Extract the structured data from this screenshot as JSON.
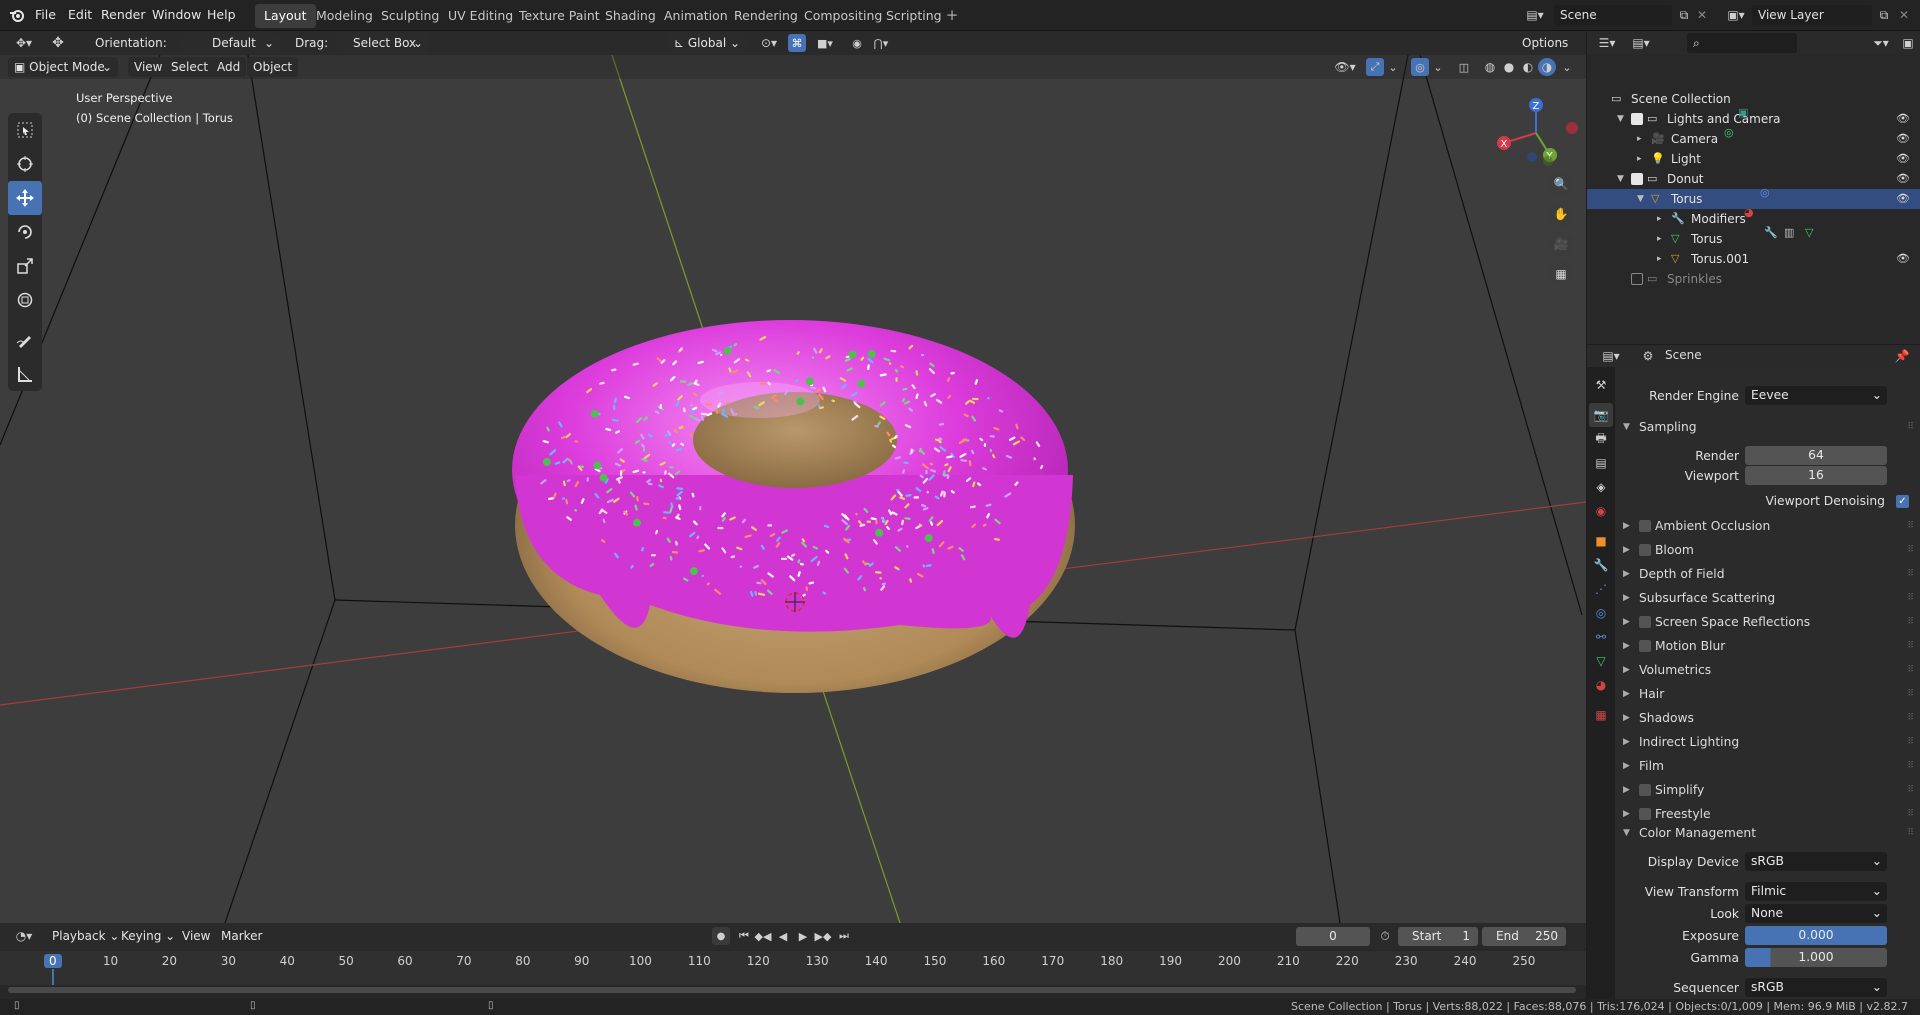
{
  "topbar": {
    "menus": [
      "File",
      "Edit",
      "Render",
      "Window",
      "Help"
    ],
    "workspaces": [
      "Layout",
      "Modeling",
      "Sculpting",
      "UV Editing",
      "Texture Paint",
      "Shading",
      "Animation",
      "Rendering",
      "Compositing",
      "Scripting"
    ],
    "active_workspace": "Layout",
    "scene_field": "Scene",
    "view_layer_field": "View Layer"
  },
  "tool_header": {
    "orientation_label": "Orientation:",
    "orientation_value": "Default",
    "drag_label": "Drag:",
    "drag_value": "Select Box",
    "transform_orientation": "Global",
    "options_label": "Options"
  },
  "viewport": {
    "mode": "Object Mode",
    "menus": [
      "View",
      "Select",
      "Add",
      "Object"
    ],
    "overlay_text_1": "User Perspective",
    "overlay_text_2": "(0) Scene Collection | Torus",
    "gizmo": {
      "x": "X",
      "y": "Y",
      "z": "Z"
    }
  },
  "outliner": {
    "rows": [
      {
        "label": "Scene Collection",
        "depth": 0
      },
      {
        "label": "Lights and Camera",
        "depth": 1
      },
      {
        "label": "Camera",
        "depth": 2
      },
      {
        "label": "Light",
        "depth": 2
      },
      {
        "label": "Donut",
        "depth": 1
      },
      {
        "label": "Torus",
        "depth": 2
      },
      {
        "label": "Modifiers",
        "depth": 3
      },
      {
        "label": "Torus",
        "depth": 3
      },
      {
        "label": "Torus.001",
        "depth": 3
      },
      {
        "label": "Sprinkles",
        "depth": 1
      }
    ]
  },
  "properties": {
    "context": "Scene",
    "render_engine_label": "Render Engine",
    "render_engine_value": "Eevee",
    "sampling_label": "Sampling",
    "render_label": "Render",
    "render_value": "64",
    "viewport_label": "Viewport",
    "viewport_value": "16",
    "viewport_denoising_label": "Viewport Denoising",
    "panels": [
      {
        "label": "Ambient Occlusion",
        "checkbox": true
      },
      {
        "label": "Bloom",
        "checkbox": true
      },
      {
        "label": "Depth of Field",
        "checkbox": false
      },
      {
        "label": "Subsurface Scattering",
        "checkbox": false
      },
      {
        "label": "Screen Space Reflections",
        "checkbox": true
      },
      {
        "label": "Motion Blur",
        "checkbox": true
      },
      {
        "label": "Volumetrics",
        "checkbox": false
      },
      {
        "label": "Hair",
        "checkbox": false
      },
      {
        "label": "Shadows",
        "checkbox": false
      },
      {
        "label": "Indirect Lighting",
        "checkbox": false
      },
      {
        "label": "Film",
        "checkbox": false
      },
      {
        "label": "Simplify",
        "checkbox": true
      },
      {
        "label": "Freestyle",
        "checkbox": true
      }
    ],
    "color_management_label": "Color Management",
    "display_device_label": "Display Device",
    "display_device_value": "sRGB",
    "view_transform_label": "View Transform",
    "view_transform_value": "Filmic",
    "look_label": "Look",
    "look_value": "None",
    "exposure_label": "Exposure",
    "exposure_value": "0.000",
    "gamma_label": "Gamma",
    "gamma_value": "1.000",
    "sequencer_label": "Sequencer",
    "sequencer_value": "sRGB"
  },
  "timeline": {
    "menus": [
      "Playback",
      "Keying",
      "View",
      "Marker"
    ],
    "current_frame": "0",
    "start_label": "Start",
    "start_value": "1",
    "end_label": "End",
    "end_value": "250",
    "ruler": [
      "0",
      "10",
      "20",
      "30",
      "40",
      "50",
      "60",
      "70",
      "80",
      "90",
      "100",
      "110",
      "120",
      "130",
      "140",
      "150",
      "160",
      "170",
      "180",
      "190",
      "200",
      "210",
      "220",
      "230",
      "240",
      "250"
    ]
  },
  "statusbar": {
    "text": "Scene Collection | Torus | Verts:88,022 | Faces:88,076 | Tris:176,024 | Objects:0/1,009 | Mem: 96.9 MiB | v2.82.7"
  },
  "colors": {
    "accent": "#4772b3",
    "icing": "#d63ad6",
    "dough": "#b8925e",
    "viewport_bg": "#3d3d3d"
  }
}
